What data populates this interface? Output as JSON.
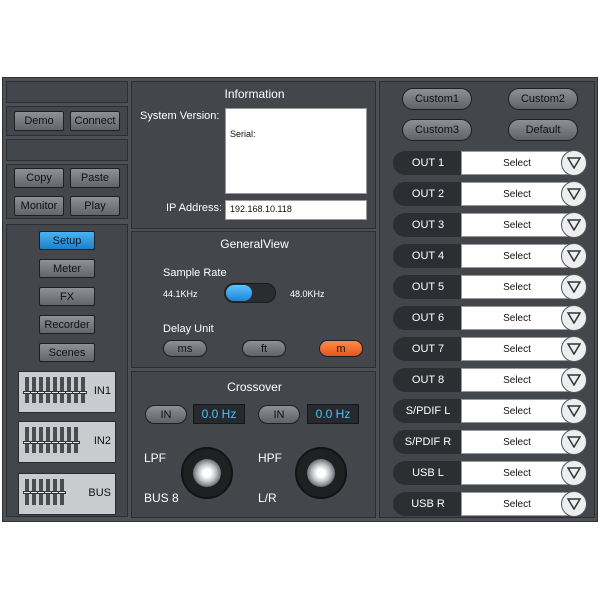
{
  "left": {
    "demo": "Demo",
    "connect": "Connect",
    "copy": "Copy",
    "paste": "Paste",
    "monitor": "Monitor",
    "play": "Play",
    "nav": [
      "Setup",
      "Meter",
      "FX",
      "Recorder",
      "Scenes"
    ],
    "channels": [
      "IN1",
      "IN2",
      "BUS"
    ]
  },
  "info": {
    "title": "Information",
    "system_version_label": "System Version:",
    "serial_text": "Serial:",
    "ip_label": "IP Address:",
    "ip_value": "192.168.10.118"
  },
  "general": {
    "title": "GeneralView",
    "sample_rate_label": "Sample Rate",
    "rate_low": "44.1KHz",
    "rate_high": "48.0KHz",
    "delay_unit_label": "Delay Unit",
    "units": [
      "ms",
      "ft",
      "m"
    ],
    "selected_unit": "m"
  },
  "crossover": {
    "title": "Crossover",
    "in_label": "IN",
    "lpf_freq": "0.0 Hz",
    "hpf_freq": "0.0 Hz",
    "lpf_label": "LPF",
    "hpf_label": "HPF",
    "bus_label": "BUS 8",
    "lr_label": "L/R"
  },
  "presets": [
    "Custom1",
    "Custom2",
    "Custom3",
    "Default"
  ],
  "outputs": [
    {
      "name": "OUT 1",
      "value": "Select"
    },
    {
      "name": "OUT 2",
      "value": "Select"
    },
    {
      "name": "OUT 3",
      "value": "Select"
    },
    {
      "name": "OUT 4",
      "value": "Select"
    },
    {
      "name": "OUT 5",
      "value": "Select"
    },
    {
      "name": "OUT 6",
      "value": "Select"
    },
    {
      "name": "OUT 7",
      "value": "Select"
    },
    {
      "name": "OUT 8",
      "value": "Select"
    },
    {
      "name": "S/PDIF L",
      "value": "Select"
    },
    {
      "name": "S/PDIF R",
      "value": "Select"
    },
    {
      "name": "USB L",
      "value": "Select"
    },
    {
      "name": "USB R",
      "value": "Select"
    }
  ],
  "colors": {
    "accent_blue": "#2a95e0",
    "accent_orange": "#f26a2a",
    "digit_text": "#4fc3f7"
  }
}
